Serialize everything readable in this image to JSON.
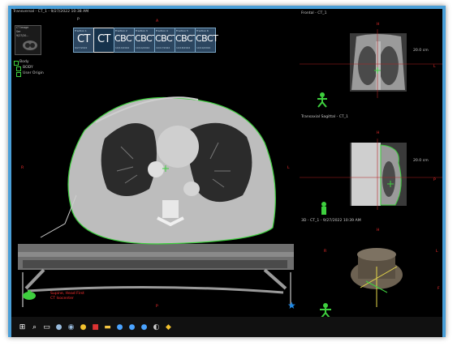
{
  "axial_view": {
    "title": "Transversal - CT_1 - 9/27/2022 10:38 AM",
    "p_label": "P",
    "orient_top": "A",
    "orient_bottom": "P",
    "orient_left": "R",
    "orient_right": "L"
  },
  "thumbnail": {
    "lines": [
      "CT Image",
      "Ser",
      "9/27/20..."
    ]
  },
  "series_list": [
    {
      "header": "Fraction 1",
      "label": "CT",
      "sub": "9/27/2022",
      "selected": false
    },
    {
      "header": "",
      "label": "CT",
      "sub": "",
      "selected": true
    },
    {
      "header": "Fraction 2",
      "label": "CBCT",
      "sub": "10/13/2022",
      "selected": false
    },
    {
      "header": "Fraction 3",
      "label": "CBCT",
      "sub": "10/14/2022",
      "selected": false
    },
    {
      "header": "Fraction 4",
      "label": "CBCT",
      "sub": "10/17/2022",
      "selected": false
    },
    {
      "header": "Fraction 5",
      "label": "CBCT",
      "sub": "10/18/2022",
      "selected": false
    },
    {
      "header": "Fraction 6",
      "label": "CBCT",
      "sub": "10/19/2022",
      "selected": false
    }
  ],
  "structures": {
    "header": "Body",
    "items": [
      {
        "label": "BODY",
        "color": "#3ecf3e"
      },
      {
        "label": "User Origin",
        "color": "#3ecf3e"
      }
    ]
  },
  "frontal_view": {
    "title": "Frontal - CT_1",
    "orient_top": "H",
    "orient_right": "L",
    "scale_label": "20.0 cm"
  },
  "sagittal_view": {
    "title": "Transaxial Sagittal - CT_1",
    "orient_top": "H",
    "orient_right": "P",
    "scale_label": "20.0 cm"
  },
  "view3d": {
    "title": "3D - CT_1 - 9/27/2022 10:39 AM",
    "orient_top": "H",
    "orient_left": "R",
    "orient_right": "L",
    "orient_bottom": "F"
  },
  "patient_info": {
    "lines": [
      "Supine, Head First",
      "CT Isocenter"
    ]
  },
  "taskbar": {
    "items": [
      {
        "name": "windows-start-icon"
      },
      {
        "name": "search-icon"
      },
      {
        "name": "task-view-icon"
      },
      {
        "name": "app-icon-1"
      },
      {
        "name": "app-icon-2"
      },
      {
        "name": "chrome-icon"
      },
      {
        "name": "app-icon-red"
      },
      {
        "name": "file-explorer-icon"
      },
      {
        "name": "app-icon-3"
      },
      {
        "name": "app-icon-4"
      },
      {
        "name": "app-icon-5"
      },
      {
        "name": "app-icon-6"
      },
      {
        "name": "app-icon-7"
      }
    ]
  },
  "colors": {
    "frame": "#4a9fd8",
    "contour": "#3ecf3e",
    "marker": "#ff3030",
    "star": "#1e88e5"
  }
}
